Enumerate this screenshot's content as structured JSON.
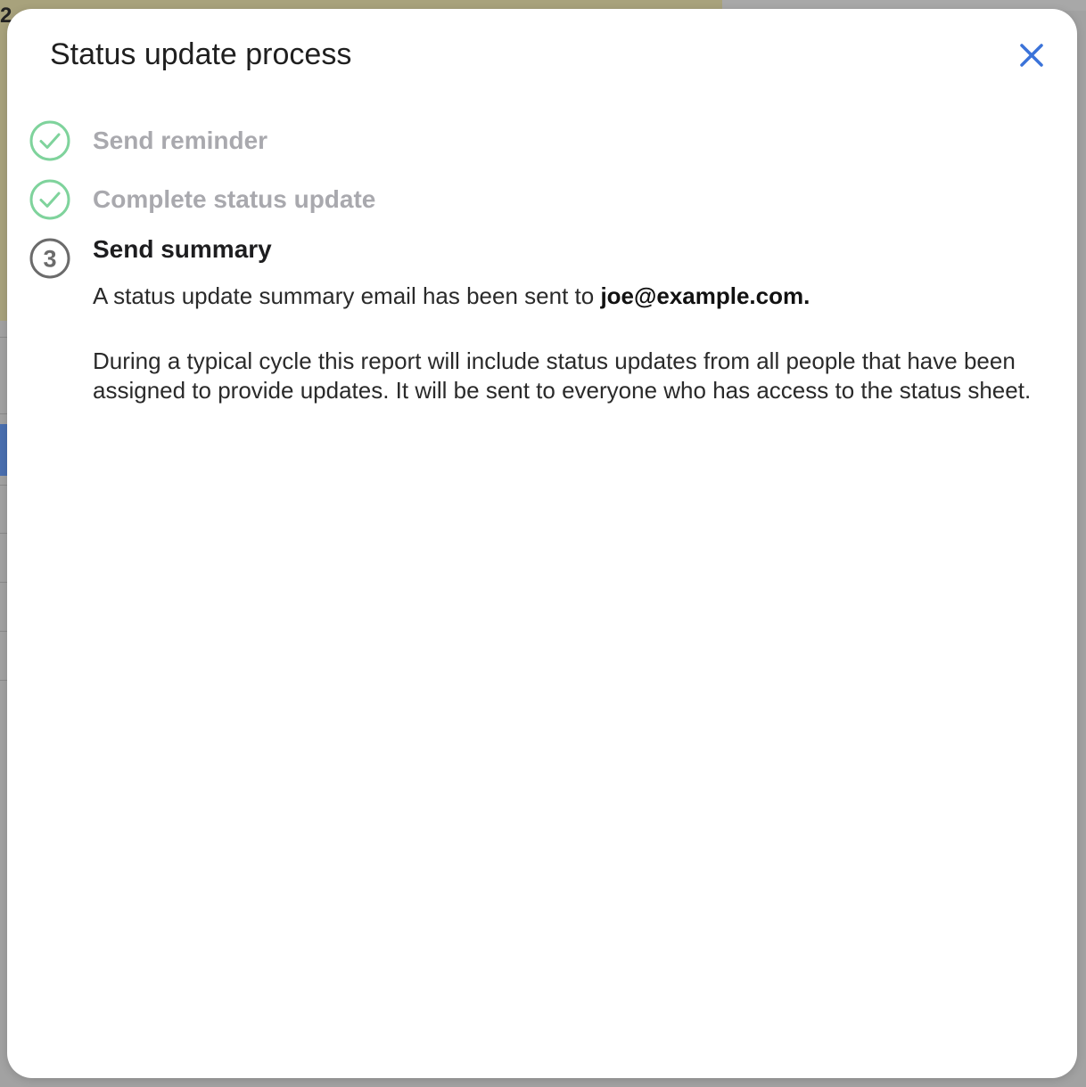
{
  "background": {
    "visible_number": "2"
  },
  "modal": {
    "title": "Status update process",
    "close_label": "Close",
    "steps": [
      {
        "label": "Send reminder",
        "status": "done"
      },
      {
        "label": "Complete status update",
        "status": "done"
      },
      {
        "label": "Send summary",
        "status": "active",
        "number": "3"
      }
    ],
    "summary_text": "A status update summary email has been sent to ",
    "summary_email": "joe@example.com.",
    "description": "During a typical cycle this report will include status updates from all people that have been assigned to provide updates. It will be sent to everyone who has access to the status sheet."
  },
  "colors": {
    "done": "#7fd39c",
    "active_ring": "#6b6b6b",
    "close": "#3b73d9"
  }
}
